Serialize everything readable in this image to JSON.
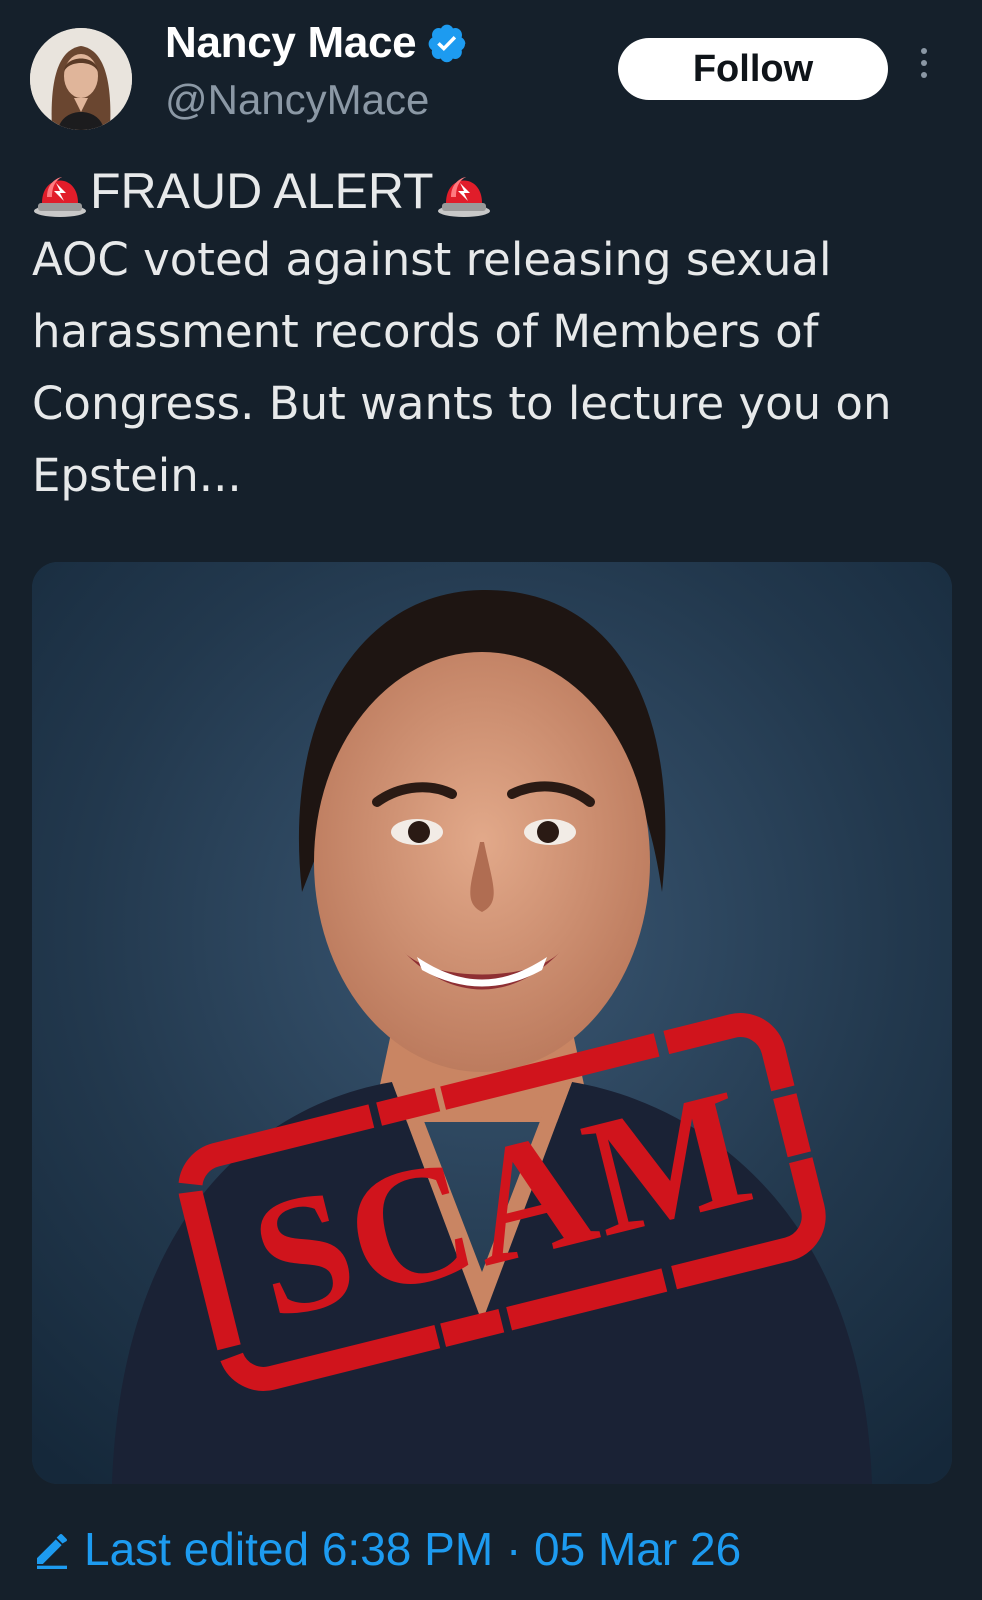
{
  "tweet": {
    "author": {
      "display_name": "Nancy Mace",
      "handle": "@NancyMace",
      "verified": true,
      "verified_color": "#1d9bf0",
      "avatar_icon": "profile-photo"
    },
    "follow_label": "Follow",
    "more_icon": "more-vertical-icon",
    "alert_text": "FRAUD ALERT",
    "alert_icon": "police-light-icon",
    "body": "AOC voted against releasing sexual harassment records of Members of Congress. But wants to lecture you on Epstein...",
    "media": {
      "description_icon": "photo",
      "stamp_text": "SCAM",
      "stamp_color": "#d0141c"
    },
    "footer": {
      "edit_icon": "pencil-icon",
      "edited_label": "Last edited",
      "time": "6:38 PM",
      "separator": "·",
      "date": "05 Mar 26"
    }
  },
  "colors": {
    "background": "#15202b",
    "text": "#e7e9ea",
    "muted": "#8b98a5",
    "accent": "#1d9bf0"
  }
}
